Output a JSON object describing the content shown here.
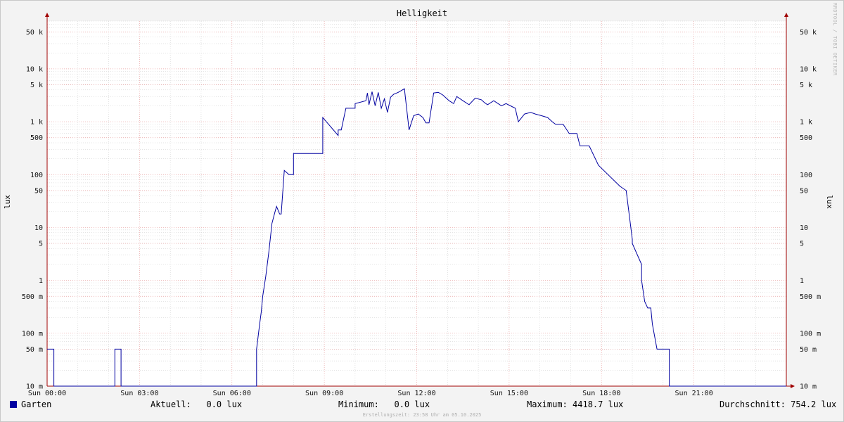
{
  "chart_data": {
    "type": "line",
    "title": "Helligkeit",
    "ylabel": "lux",
    "yscale": "log",
    "ylim": [
      0.01,
      80000
    ],
    "xlim_hours": [
      0,
      24
    ],
    "x_ticks": [
      {
        "hour": 0,
        "label": "Sun 00:00"
      },
      {
        "hour": 3,
        "label": "Sun 03:00"
      },
      {
        "hour": 6,
        "label": "Sun 06:00"
      },
      {
        "hour": 9,
        "label": "Sun 09:00"
      },
      {
        "hour": 12,
        "label": "Sun 12:00"
      },
      {
        "hour": 15,
        "label": "Sun 15:00"
      },
      {
        "hour": 18,
        "label": "Sun 18:00"
      },
      {
        "hour": 21,
        "label": "Sun 21:00"
      }
    ],
    "y_ticks": [
      {
        "value": 0.01,
        "label": "10 m"
      },
      {
        "value": 0.05,
        "label": "50 m"
      },
      {
        "value": 0.1,
        "label": "100 m"
      },
      {
        "value": 0.5,
        "label": "500 m"
      },
      {
        "value": 1,
        "label": "1"
      },
      {
        "value": 5,
        "label": "5"
      },
      {
        "value": 10,
        "label": "10"
      },
      {
        "value": 50,
        "label": "50"
      },
      {
        "value": 100,
        "label": "100"
      },
      {
        "value": 500,
        "label": "500"
      },
      {
        "value": 1000,
        "label": "1 k"
      },
      {
        "value": 5000,
        "label": "5 k"
      },
      {
        "value": 10000,
        "label": "10 k"
      },
      {
        "value": 50000,
        "label": "50 k"
      }
    ],
    "grid": true,
    "series": [
      {
        "name": "Garten",
        "color": "#0000a0",
        "x_hours": [
          0,
          0.22,
          0.22,
          2.2,
          2.2,
          2.4,
          2.4,
          6.8,
          6.8,
          6.9,
          6.95,
          7.0,
          7.1,
          7.2,
          7.3,
          7.4,
          7.45,
          7.55,
          7.6,
          7.7,
          7.85,
          7.85,
          8.0,
          8.0,
          8.1,
          8.2,
          8.3,
          8.95,
          8.95,
          9.45,
          9.45,
          9.55,
          9.55,
          9.7,
          9.85,
          10.0,
          10.0,
          10.35,
          10.4,
          10.45,
          10.55,
          10.65,
          10.75,
          10.85,
          10.95,
          11.05,
          11.15,
          11.25,
          11.4,
          11.6,
          11.75,
          11.9,
          12.05,
          12.2,
          12.3,
          12.4,
          12.55,
          12.7,
          12.85,
          13.05,
          13.2,
          13.3,
          13.5,
          13.7,
          13.9,
          14.1,
          14.2,
          14.3,
          14.5,
          14.75,
          14.9,
          15.2,
          15.3,
          15.5,
          15.7,
          15.85,
          16.05,
          16.25,
          16.4,
          16.5,
          16.6,
          16.75,
          16.95,
          17.2,
          17.3,
          17.6,
          17.6,
          17.9,
          17.9,
          18.6,
          18.6,
          18.8,
          18.8,
          19.0,
          19.0,
          19.3,
          19.3,
          19.4,
          19.5,
          19.6,
          19.65,
          19.8,
          19.85,
          19.95,
          20.0,
          20.2,
          20.2,
          20.35,
          20.4,
          20.4,
          24
        ],
        "values": [
          0.05,
          0.05,
          0.01,
          0.01,
          0.05,
          0.05,
          0.01,
          0.01,
          0.05,
          0.15,
          0.25,
          0.5,
          1.2,
          3.5,
          12,
          20,
          25,
          18,
          18,
          120,
          100,
          100,
          100,
          250,
          250,
          250,
          250,
          250,
          1200,
          550,
          700,
          700,
          700,
          1800,
          1800,
          1800,
          2200,
          2500,
          3500,
          2100,
          3700,
          2000,
          3600,
          1800,
          2700,
          1500,
          2900,
          3300,
          3600,
          4200,
          700,
          1300,
          1400,
          1200,
          950,
          950,
          3500,
          3600,
          3200,
          2500,
          2200,
          3000,
          2500,
          2100,
          2800,
          2600,
          2300,
          2100,
          2500,
          2000,
          2200,
          1800,
          1000,
          1400,
          1500,
          1400,
          1300,
          1200,
          1000,
          900,
          900,
          900,
          600,
          600,
          350,
          350,
          350,
          150,
          150,
          60,
          60,
          50,
          50,
          6,
          5,
          2,
          1,
          0.4,
          0.3,
          0.3,
          0.15,
          0.05,
          0.05,
          0.05,
          0.05,
          0.05,
          0.01,
          0.01,
          0.01,
          0.01,
          0.01
        ]
      }
    ]
  },
  "legend": {
    "series_name": "Garten",
    "current": "Aktuell:   0.0 lux",
    "minimum": "Minimum:   0.0 lux",
    "maximum": "Maximum: 4418.7 lux",
    "average": "Durchschnitt: 754.2 lux"
  },
  "footer": {
    "created": "Erstellungszeit: 23:58 Uhr am 05.10.2025",
    "watermark": "RRDTOOL / TOBI OETIKER"
  },
  "colors": {
    "line": "#0000a0",
    "major_grid": "#e8a0a0",
    "minor_grid": "#c8c8c8",
    "axis": "#a00000",
    "canvas": "#ffffff"
  }
}
